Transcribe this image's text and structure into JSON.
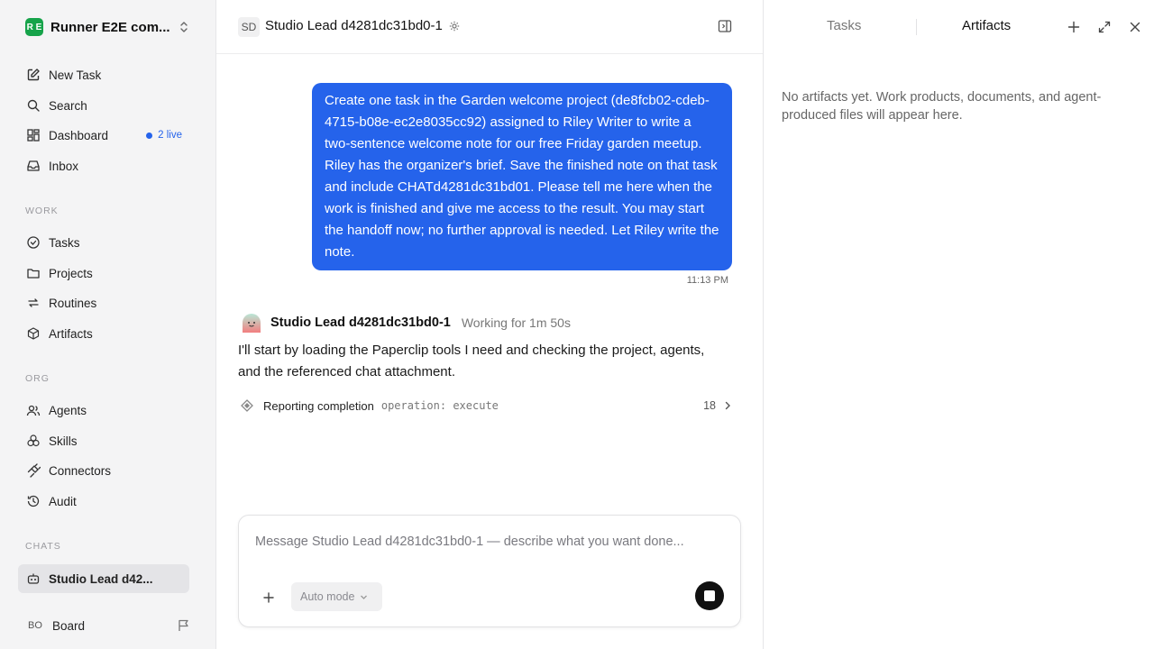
{
  "workspace": {
    "logo": "R E",
    "name": "Runner E2E com..."
  },
  "nav": {
    "new_task": "New Task",
    "search": "Search",
    "dashboard": "Dashboard",
    "dashboard_live": "2 live",
    "inbox": "Inbox"
  },
  "sections": {
    "work": "WORK",
    "org": "ORG",
    "chats": "CHATS"
  },
  "work": {
    "tasks": "Tasks",
    "projects": "Projects",
    "routines": "Routines",
    "artifacts": "Artifacts"
  },
  "org": {
    "agents": "Agents",
    "skills": "Skills",
    "connectors": "Connectors",
    "audit": "Audit"
  },
  "chats": {
    "item": "Studio Lead d42..."
  },
  "board": {
    "initials": "BO",
    "label": "Board"
  },
  "header": {
    "avatar": "SD",
    "title": "Studio Lead d4281dc31bd0-1"
  },
  "user_message": {
    "text": "Create one task in the Garden welcome project (de8fcb02-cdeb-4715-b08e-ec2e8035cc92) assigned to Riley Writer to write a two-sentence welcome note for our free Friday garden meetup. Riley has the organizer's brief. Save the finished note on that task and include CHATd4281dc31bd01. Please tell me here when the work is finished and give me access to the result. You may start the handoff now; no further approval is needed. Let Riley write the note.",
    "time": "11:13 PM"
  },
  "agent_message": {
    "name": "Studio Lead d4281dc31bd0-1",
    "status": "Working for 1m 50s",
    "text": "I'll start by loading the Paperclip tools I need and checking the project, agents, and the referenced chat attachment."
  },
  "tool_call": {
    "label": "Reporting completion",
    "operation": "operation: execute",
    "count": "18"
  },
  "composer": {
    "placeholder": "Message Studio Lead d4281dc31bd0-1 — describe what you want done...",
    "value": "",
    "mode": "Auto mode"
  },
  "panel": {
    "tab_tasks": "Tasks",
    "tab_artifacts": "Artifacts",
    "active_tab": "Artifacts",
    "empty": "No artifacts yet. Work products, documents, and agent-produced files will appear here."
  },
  "colors": {
    "accent": "#2563eb",
    "logo": "#16a34a",
    "sidebar": "#f4f4f5"
  }
}
